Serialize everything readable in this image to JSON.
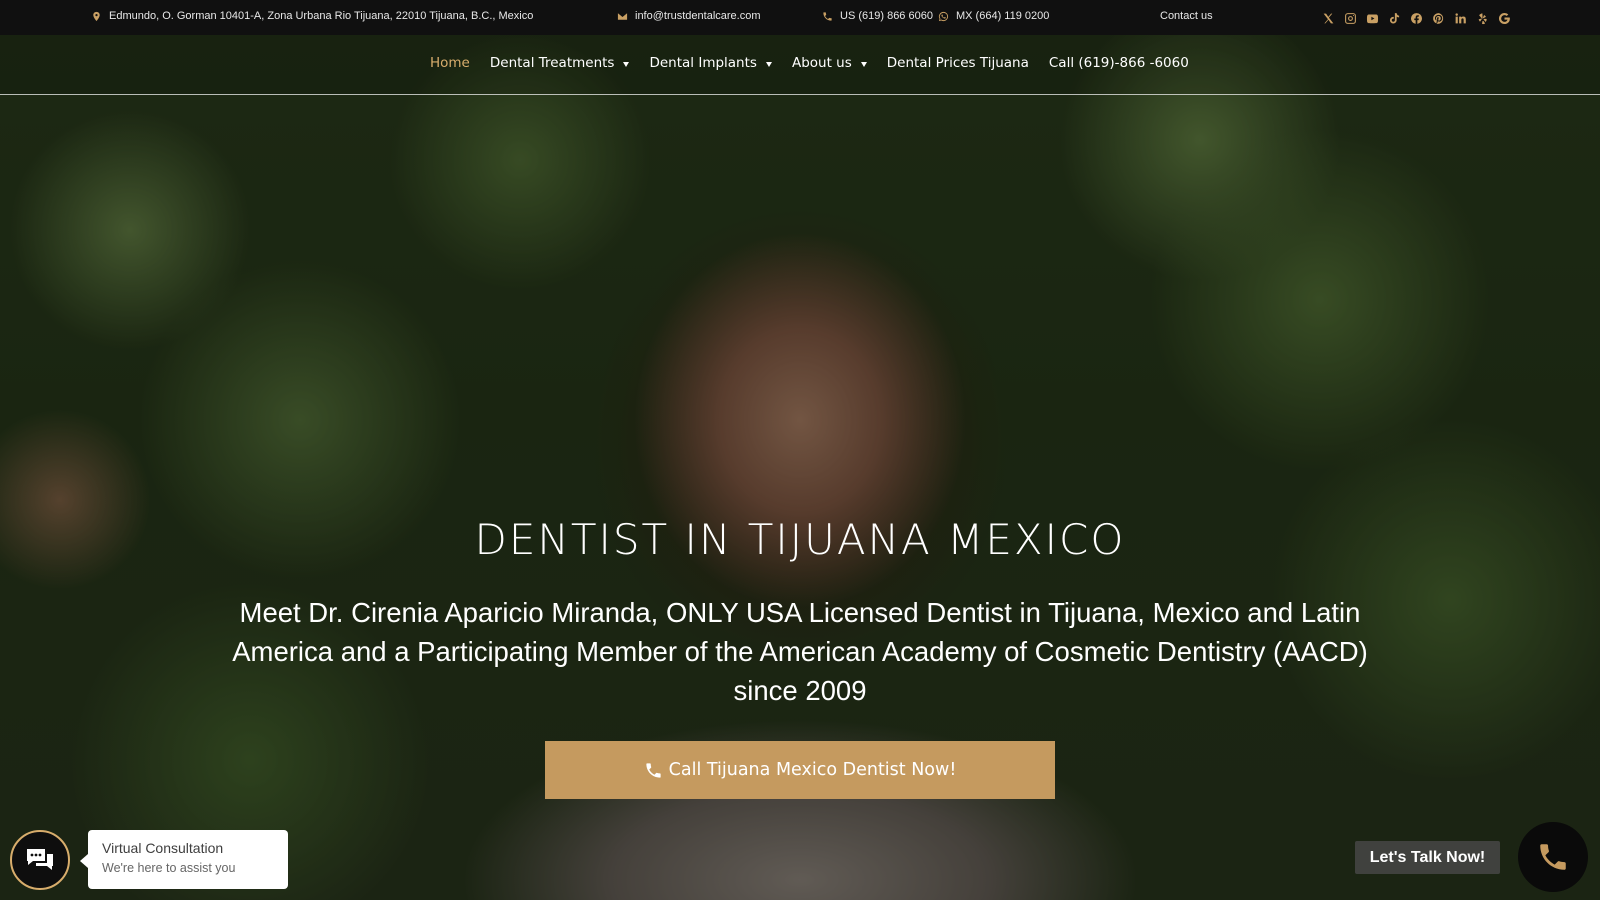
{
  "topbar": {
    "address": "Edmundo, O. Gorman 10401-A, Zona Urbana Rio Tijuana, 22010 Tijuana, B.C., Mexico",
    "email": "info@trustdentalcare.com",
    "phone_us": "US (619) 866 6060",
    "phone_mx": "MX (664) 119 0200",
    "contact": "Contact us",
    "socials": [
      "x-icon",
      "instagram-icon",
      "youtube-icon",
      "tiktok-icon",
      "facebook-icon",
      "pinterest-icon",
      "linkedin-icon",
      "yelp-icon",
      "google-icon"
    ]
  },
  "nav": {
    "home": "Home",
    "treatments": "Dental Treatments",
    "implants": "Dental Implants",
    "about": "About us",
    "prices": "Dental Prices Tijuana",
    "call": "Call (619)-866 -6060"
  },
  "hero": {
    "title": "DENTIST IN TIJUANA MEXICO",
    "subtitle": "Meet Dr. Cirenia Aparicio Miranda, ONLY USA Licensed Dentist in Tijuana, Mexico and Latin America and a Participating Member of the American Academy of Cosmetic Dentistry (AACD) since 2009",
    "cta": "Call Tijuana Mexico Dentist Now!"
  },
  "chat": {
    "title": "Virtual Consultation",
    "subtitle": "We're here to assist you"
  },
  "talk": {
    "label": "Let's Talk Now!"
  },
  "colors": {
    "accent": "#c59a5f",
    "nav_active": "#d8ad6c",
    "topbar_bg": "#101010"
  }
}
